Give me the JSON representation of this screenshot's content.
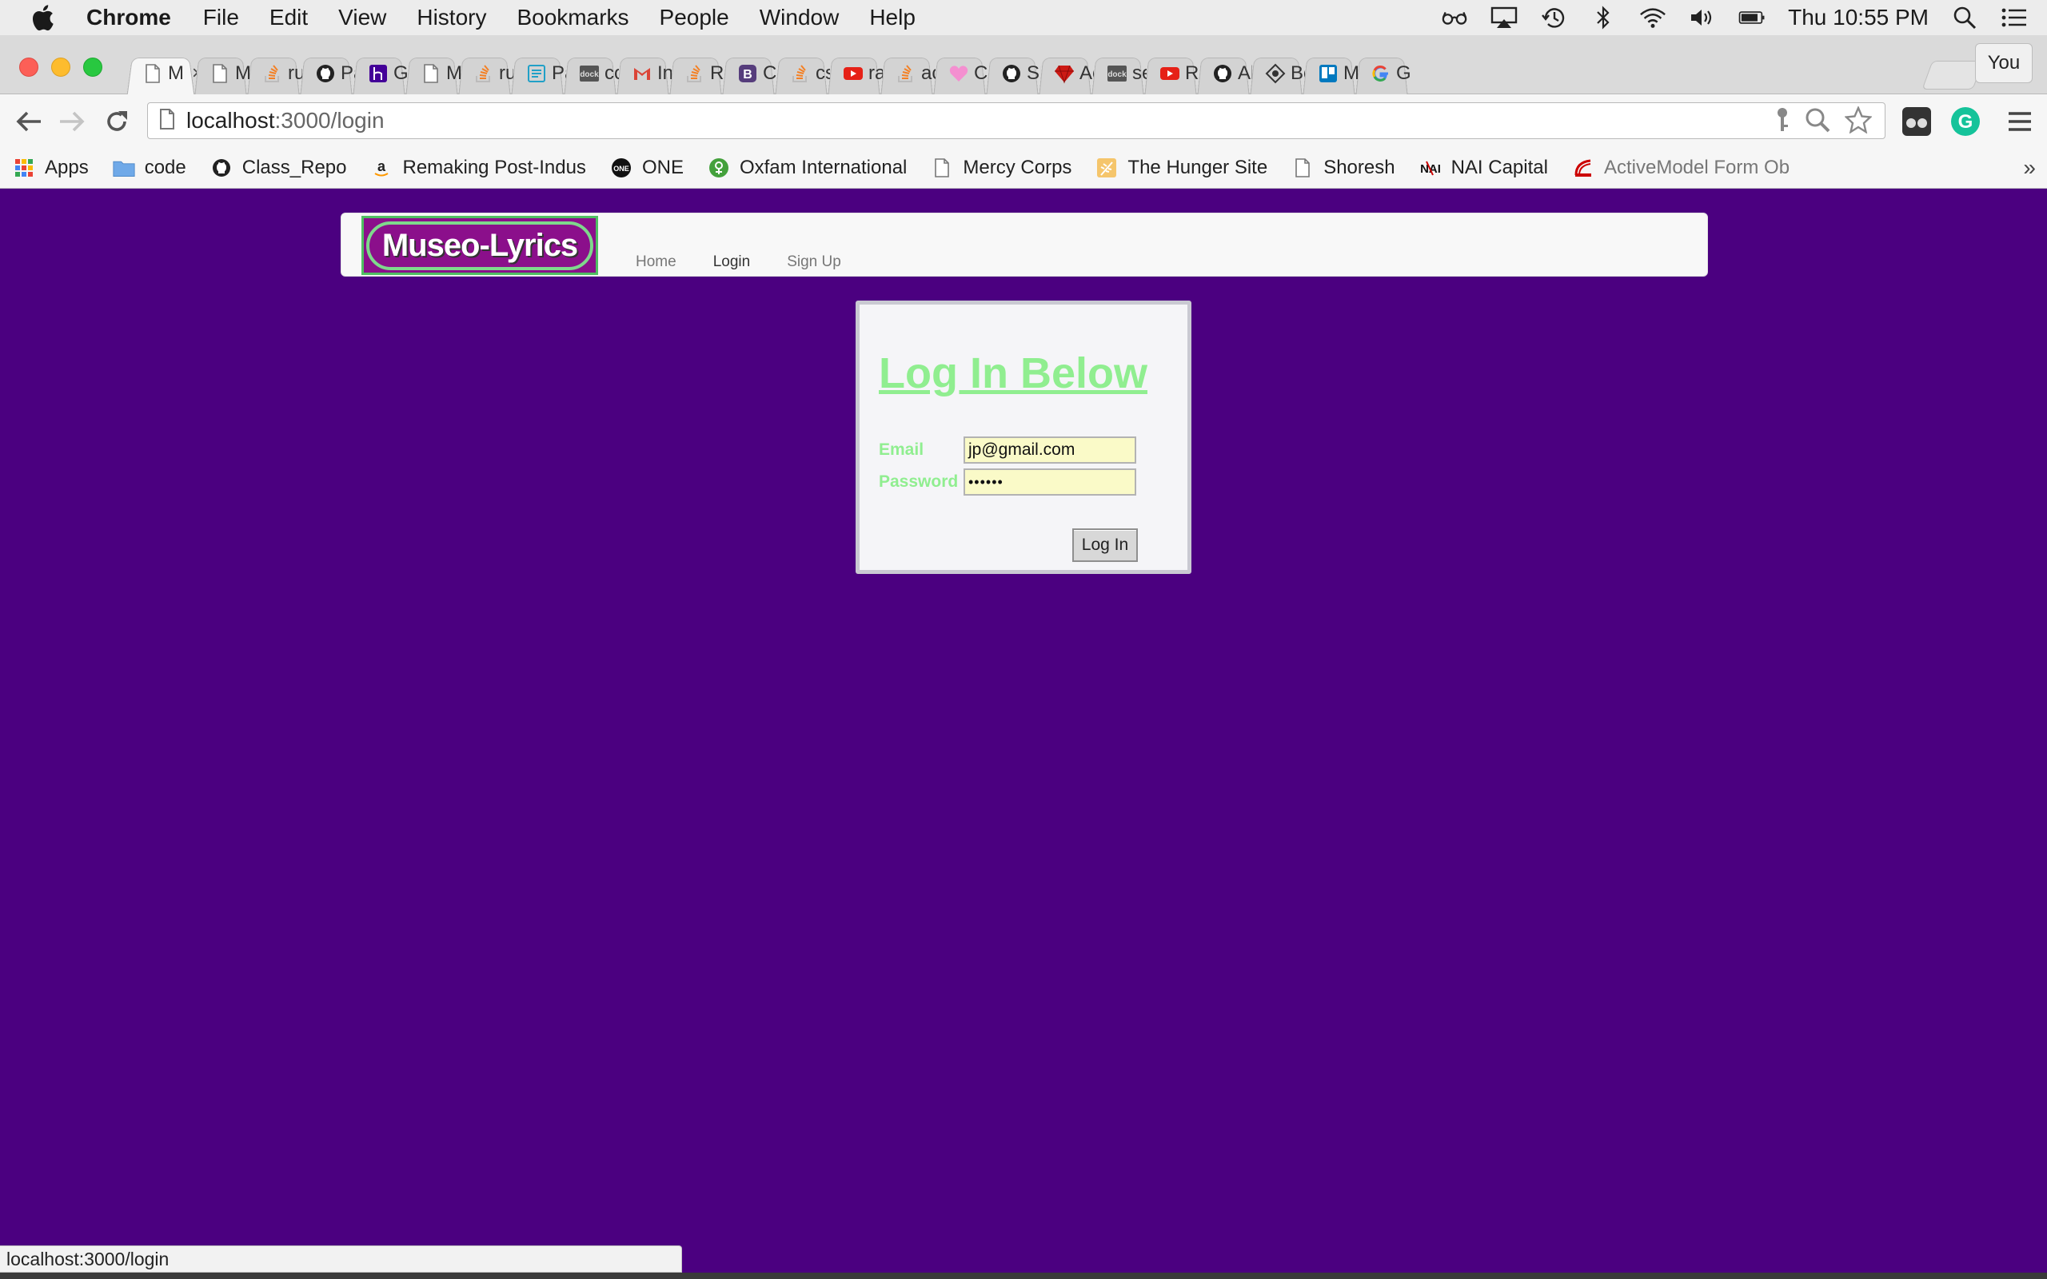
{
  "menubar": {
    "app_name": "Chrome",
    "items": [
      "File",
      "Edit",
      "View",
      "History",
      "Bookmarks",
      "People",
      "Window",
      "Help"
    ],
    "clock": "Thu 10:55 PM"
  },
  "tabs": [
    {
      "title": "M",
      "icon": "page-icon",
      "active": true,
      "close": "×"
    },
    {
      "title": "Mu",
      "icon": "page-icon"
    },
    {
      "title": "rul",
      "icon": "stackoverflow-icon"
    },
    {
      "title": "Pa",
      "icon": "github-icon"
    },
    {
      "title": "Ge",
      "icon": "heroku-icon"
    },
    {
      "title": "Mu",
      "icon": "page-icon"
    },
    {
      "title": "rul",
      "icon": "stackoverflow-icon"
    },
    {
      "title": "Pa",
      "icon": "document-icon"
    },
    {
      "title": "co",
      "icon": "dock-icon"
    },
    {
      "title": "Inb",
      "icon": "gmail-icon"
    },
    {
      "title": "Ru",
      "icon": "stackoverflow-icon"
    },
    {
      "title": "Co",
      "icon": "bootstrap-icon"
    },
    {
      "title": "cs",
      "icon": "stackoverflow-icon"
    },
    {
      "title": "rat",
      "icon": "youtube-icon"
    },
    {
      "title": "ac",
      "icon": "stackoverflow-icon"
    },
    {
      "title": "Cr",
      "icon": "heart-icon"
    },
    {
      "title": "SE",
      "icon": "github-icon"
    },
    {
      "title": "Ac",
      "icon": "ruby-icon"
    },
    {
      "title": "se",
      "icon": "dock-icon"
    },
    {
      "title": "Ra",
      "icon": "youtube-icon"
    },
    {
      "title": "Al",
      "icon": "github-icon"
    },
    {
      "title": "Bo",
      "icon": "diamond-icon"
    },
    {
      "title": "Mu",
      "icon": "trello-icon"
    },
    {
      "title": "Go",
      "icon": "google-icon"
    }
  ],
  "profile_button": "You",
  "address_bar": {
    "host": "localhost",
    "path": ":3000/login"
  },
  "bookmarks": [
    {
      "label": "Apps",
      "icon": "apps-grid-icon"
    },
    {
      "label": "code",
      "icon": "folder-icon"
    },
    {
      "label": "Class_Repo",
      "icon": "github-icon"
    },
    {
      "label": "Remaking Post-Indus",
      "icon": "amazon-icon"
    },
    {
      "label": "ONE",
      "icon": "one-icon"
    },
    {
      "label": "Oxfam International",
      "icon": "oxfam-icon"
    },
    {
      "label": "Mercy Corps",
      "icon": "page-icon"
    },
    {
      "label": "The Hunger Site",
      "icon": "wheat-icon"
    },
    {
      "label": "Shoresh",
      "icon": "page-icon"
    },
    {
      "label": "NAI Capital",
      "icon": "nai-icon"
    },
    {
      "label": "ActiveModel Form Ob",
      "icon": "rails-icon"
    }
  ],
  "bookmarks_more": "»",
  "site": {
    "brand": "Museo-Lyrics",
    "nav": [
      {
        "label": "Home",
        "active": false
      },
      {
        "label": "Login",
        "active": true
      },
      {
        "label": "Sign Up",
        "active": false
      }
    ]
  },
  "login": {
    "title": "Log In Below",
    "email_label": "Email",
    "email_value": "jp@gmail.com",
    "password_label": "Password",
    "password_value": "••••••",
    "submit_label": "Log In"
  },
  "status_url": "localhost:3000/login",
  "colors": {
    "page_background": "#4b0080",
    "brand_background": "#8b0f8b",
    "accent_green": "#90ee90",
    "autofill_yellow": "#fafac8"
  }
}
